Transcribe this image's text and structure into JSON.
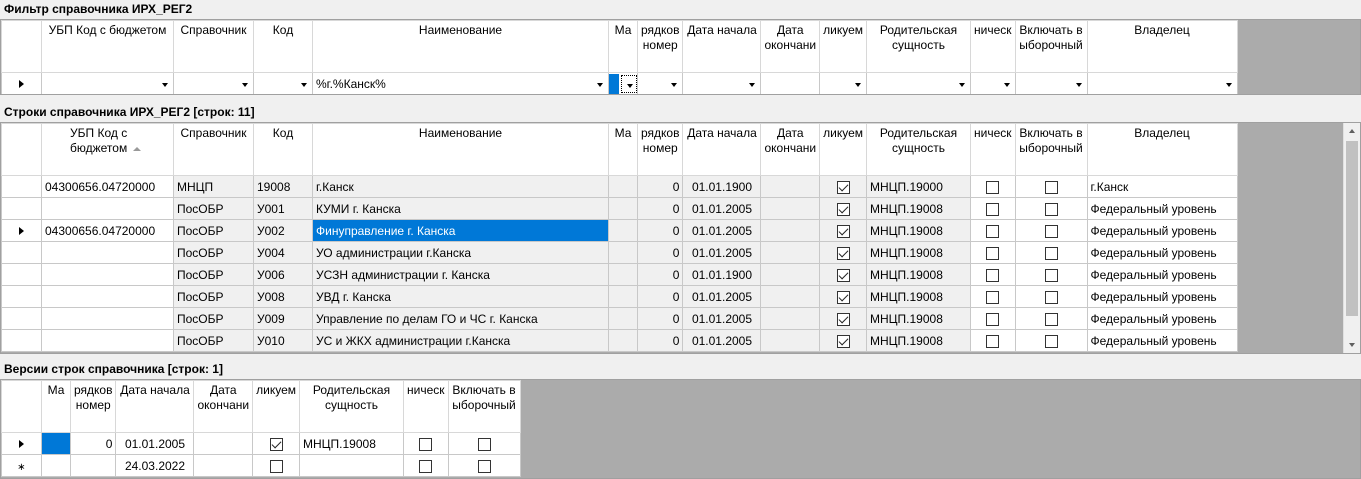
{
  "filter": {
    "title": "Фильтр справочника ИРХ_РЕГ2",
    "headers": [
      "УБП Код с бюджетом",
      "Справочник",
      "Код",
      "Наименование",
      "Ма",
      "рядков номер",
      "Дата начала",
      "Дата окончани",
      "ликуем",
      "Родительская сущность",
      "ническ",
      "Включать в ыборочный",
      "Владелец"
    ],
    "values": {
      "name": "%г.%Канск%"
    }
  },
  "rows": {
    "title": "Строки справочника ИРХ_РЕГ2 [строк: 11]",
    "headers": [
      "УБП Код с бюджетом",
      "Справочник",
      "Код",
      "Наименование",
      "Ма",
      "рядков номер",
      "Дата начала",
      "Дата окончани",
      "ликуем",
      "Родительская сущность",
      "ническ",
      "Включать в ыборочный",
      "Владелец"
    ],
    "items": [
      {
        "ubp": "04300656.04720000",
        "ref": "МНЦП",
        "code": "19008",
        "name": "г.Канск",
        "num": "0",
        "start": "01.01.1900",
        "end": "",
        "flag1": true,
        "parent": "МНЦП.19000",
        "flag2": false,
        "flag3": false,
        "owner": "г.Канск"
      },
      {
        "ubp": "",
        "ref": "ПосОБР",
        "code": "У001",
        "name": "КУМИ г. Канска",
        "num": "0",
        "start": "01.01.2005",
        "end": "",
        "flag1": true,
        "parent": "МНЦП.19008",
        "flag2": false,
        "flag3": false,
        "owner": "Федеральный уровень"
      },
      {
        "ubp": "04300656.04720000",
        "ref": "ПосОБР",
        "code": "У002",
        "name": "Финуправление г. Канска",
        "num": "0",
        "start": "01.01.2005",
        "end": "",
        "flag1": true,
        "parent": "МНЦП.19008",
        "flag2": false,
        "flag3": false,
        "owner": "Федеральный уровень"
      },
      {
        "ubp": "",
        "ref": "ПосОБР",
        "code": "У004",
        "name": "УО администрации г.Канска",
        "num": "0",
        "start": "01.01.2005",
        "end": "",
        "flag1": true,
        "parent": "МНЦП.19008",
        "flag2": false,
        "flag3": false,
        "owner": "Федеральный уровень"
      },
      {
        "ubp": "",
        "ref": "ПосОБР",
        "code": "У006",
        "name": "УСЗН администрации г. Канска",
        "num": "0",
        "start": "01.01.1900",
        "end": "",
        "flag1": true,
        "parent": "МНЦП.19008",
        "flag2": false,
        "flag3": false,
        "owner": "Федеральный уровень"
      },
      {
        "ubp": "",
        "ref": "ПосОБР",
        "code": "У008",
        "name": "УВД г. Канска",
        "num": "0",
        "start": "01.01.2005",
        "end": "",
        "flag1": true,
        "parent": "МНЦП.19008",
        "flag2": false,
        "flag3": false,
        "owner": "Федеральный уровень"
      },
      {
        "ubp": "",
        "ref": "ПосОБР",
        "code": "У009",
        "name": "Управление по делам ГО и ЧС г. Канска",
        "num": "0",
        "start": "01.01.2005",
        "end": "",
        "flag1": true,
        "parent": "МНЦП.19008",
        "flag2": false,
        "flag3": false,
        "owner": "Федеральный уровень"
      },
      {
        "ubp": "",
        "ref": "ПосОБР",
        "code": "У010",
        "name": "УС и ЖКХ администрации г.Канска",
        "num": "0",
        "start": "01.01.2005",
        "end": "",
        "flag1": true,
        "parent": "МНЦП.19008",
        "flag2": false,
        "flag3": false,
        "owner": "Федеральный уровень"
      }
    ]
  },
  "versions": {
    "title": "Версии строк справочника [строк: 1]",
    "headers": [
      "Ма",
      "рядков номер",
      "Дата начала",
      "Дата окончани",
      "ликуем",
      "Родительская сущность",
      "ническ",
      "Включать в ыборочный"
    ],
    "items": [
      {
        "num": "0",
        "start": "01.01.2005",
        "end": "",
        "flag1": true,
        "parent": "МНЦП.19008",
        "flag2": false,
        "flag3": false
      },
      {
        "num": "",
        "start": "24.03.2022",
        "end": "",
        "flag1": false,
        "parent": "",
        "flag2": false,
        "flag3": false
      }
    ]
  }
}
